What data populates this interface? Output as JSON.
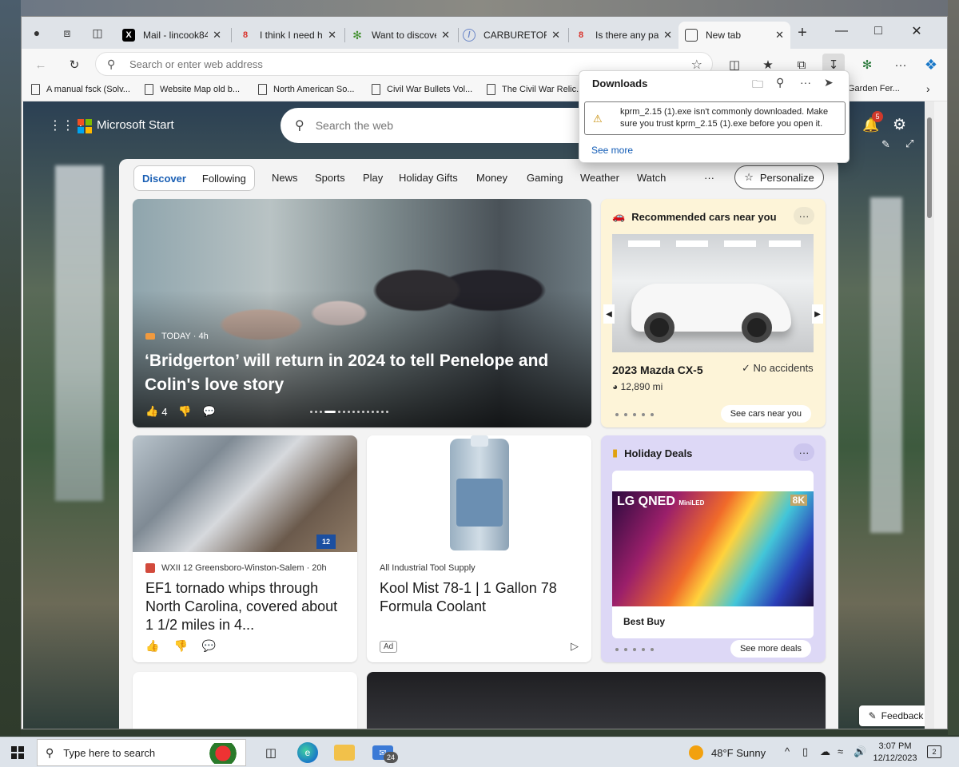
{
  "tabs": [
    {
      "label": "Mail - lincook84",
      "fav": "X",
      "fav_color": "#000000"
    },
    {
      "label": "I think I need help",
      "fav": "8",
      "fav_color": "#d9322b"
    },
    {
      "label": "Want to discover",
      "fav": "",
      "fav_color": "#3e8e2a"
    },
    {
      "label": "CARBURETOR -",
      "fav": "",
      "fav_color": "#6a86c8"
    },
    {
      "label": "Is there any part",
      "fav": "8",
      "fav_color": "#d9322b"
    },
    {
      "label": "New tab",
      "fav": "",
      "fav_color": "#3a3a3a"
    }
  ],
  "address": {
    "placeholder": "Search or enter web address"
  },
  "bookmarks": [
    "A manual fsck (Solv...",
    "Website Map old b...",
    "North American So...",
    "Civil War Bullets Vol...",
    "The Civil War Relic..."
  ],
  "bookmarks_overflow": "Garden Fer...",
  "downloads": {
    "title": "Downloads",
    "message": "kprm_2.15 (1).exe isn't commonly downloaded. Make sure you trust kprm_2.15 (1).exe before you open it.",
    "see_more": "See more"
  },
  "start": {
    "brand": "Microsoft Start",
    "search_placeholder": "Search the web",
    "notifications": "5"
  },
  "nav": {
    "discover": "Discover",
    "following": "Following",
    "links": [
      "News",
      "Sports",
      "Play",
      "Holiday Gifts",
      "Money",
      "Gaming",
      "Weather",
      "Watch"
    ],
    "overflow": "···",
    "personalize": "Personalize"
  },
  "hero": {
    "source": "TODAY · 4h",
    "title": "‘Bridgerton’ will return in 2024 to tell Penelope and Colin's love story",
    "likes": "4"
  },
  "cars": {
    "heading": "Recommended cars near you",
    "model": "2023 Mazda CX-5",
    "accidents": "No accidents",
    "miles": "12,890 mi",
    "cta": "See cars near you"
  },
  "tornado": {
    "source": "WXII 12 Greensboro-Winston-Salem · 20h",
    "title": "EF1 tornado whips through North Carolina, covered about 1 1/2 miles in 4...",
    "badge": "12"
  },
  "coolant": {
    "source": "All Industrial Tool Supply",
    "title": "Kool Mist 78-1 | 1 Gallon 78 Formula Coolant",
    "ad": "Ad"
  },
  "deals": {
    "heading": "Holiday Deals",
    "tv_brand": "LG QNED",
    "tv_sub": "MiniLED",
    "tv_res": "8K",
    "store": "Best Buy",
    "cta": "See more deals"
  },
  "feedback": "Feedback",
  "taskbar": {
    "search": "Type here to search",
    "mail_badge": "24",
    "weather": "48°F  Sunny",
    "time": "3:07 PM",
    "date": "12/12/2023",
    "notif_count": "2"
  }
}
